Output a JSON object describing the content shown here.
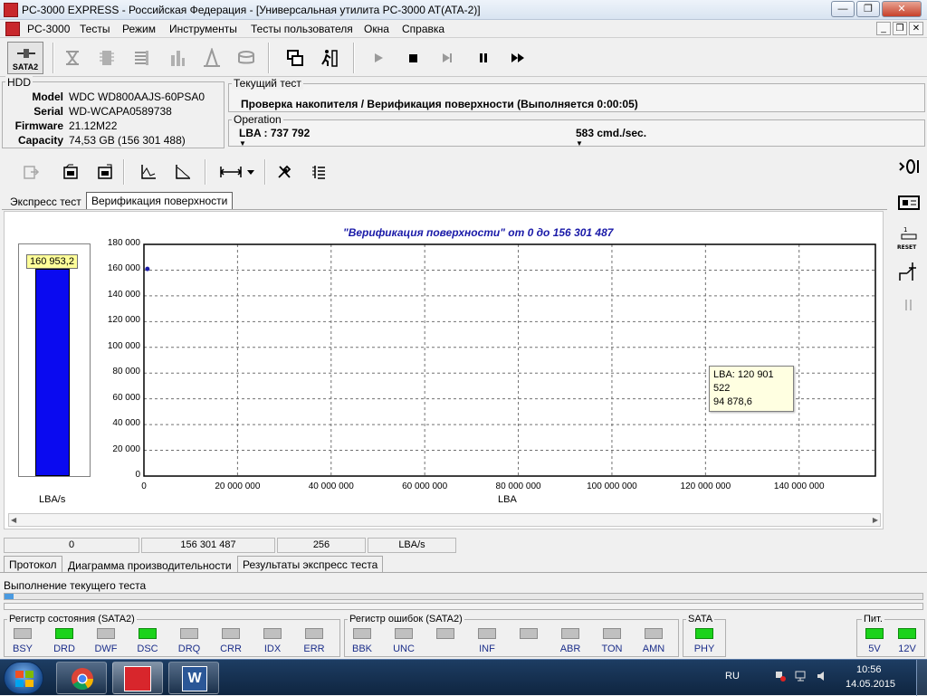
{
  "window": {
    "title": "PC-3000 EXPRESS - Российская Федерация - [Универсальная утилита PC-3000 AT(ATA-2)]",
    "btn_min": "—",
    "btn_max": "❐",
    "btn_close": "✕"
  },
  "menu": [
    "PC-3000",
    "Тесты",
    "Режим",
    "Инструменты",
    "Тесты пользователя",
    "Окна",
    "Справка"
  ],
  "mdi_buttons": [
    "_",
    "❐",
    "✕"
  ],
  "toolbar": {
    "sata_label": "SATA2"
  },
  "hdd": {
    "group_label": "HDD",
    "rows": [
      {
        "key": "Model",
        "value": "WDC WD800AAJS-60PSA0"
      },
      {
        "key": "Serial",
        "value": "WD-WCAPA0589738"
      },
      {
        "key": "Firmware",
        "value": "21.12M22"
      },
      {
        "key": "Capacity",
        "value": "74,53 GB (156 301 488)"
      }
    ]
  },
  "current_test": {
    "group_label": "Текущий тест",
    "text": "Проверка накопителя / Верификация поверхности (Выполняется 0:00:05)"
  },
  "operation": {
    "group_label": "Operation",
    "lba": "LBA : 737 792",
    "rate": "583 cmd./sec."
  },
  "chart_tabs": [
    "Экспресс тест",
    "Верификация поверхности"
  ],
  "chart_data": {
    "type": "line",
    "title": "\"Верификация поверхности\" от 0 до 156 301 487",
    "xlabel": "LBA",
    "ylabel": "",
    "xlim": [
      0,
      156301487
    ],
    "ylim": [
      0,
      180000
    ],
    "x_ticks": [
      "0",
      "20 000 000",
      "40 000 000",
      "60 000 000",
      "80 000 000",
      "100 000 000",
      "120 000 000",
      "140 000 000"
    ],
    "y_ticks": [
      "0",
      "20 000",
      "40 000",
      "60 000",
      "80 000",
      "100 000",
      "120 000",
      "140 000",
      "160 000",
      "180 000"
    ],
    "grid": true,
    "points": [
      {
        "x": 737792,
        "y": 160953.2
      }
    ],
    "side_bar": {
      "value": 160953.2,
      "label": "160 953,2",
      "unit": "LBA/s"
    },
    "tooltip": {
      "line1": "LBA: 120 901 522",
      "line2": "94 878,6"
    }
  },
  "status_cells": [
    "0",
    "156 301 487",
    "256",
    "LBA/s"
  ],
  "bottom_tabs": [
    "Протокол",
    "Диаграмма производительности",
    "Результаты экспресс теста"
  ],
  "progress": {
    "label": "Выполнение текущего теста",
    "fraction": 0.01
  },
  "status_register": {
    "label": "Регистр состояния (SATA2)",
    "leds": [
      {
        "name": "BSY",
        "on": false
      },
      {
        "name": "DRD",
        "on": true
      },
      {
        "name": "DWF",
        "on": false
      },
      {
        "name": "DSC",
        "on": true
      },
      {
        "name": "DRQ",
        "on": false
      },
      {
        "name": "CRR",
        "on": false
      },
      {
        "name": "IDX",
        "on": false
      },
      {
        "name": "ERR",
        "on": false
      }
    ]
  },
  "error_register": {
    "label": "Регистр ошибок  (SATA2)",
    "leds": [
      {
        "name": "BBK",
        "on": false
      },
      {
        "name": "UNC",
        "on": false
      },
      {
        "name": "",
        "on": false
      },
      {
        "name": "INF",
        "on": false
      },
      {
        "name": "",
        "on": false
      },
      {
        "name": "ABR",
        "on": false
      },
      {
        "name": "TON",
        "on": false
      },
      {
        "name": "AMN",
        "on": false
      }
    ]
  },
  "sata": {
    "label": "SATA",
    "led": "PHY",
    "on": true
  },
  "power": {
    "label": "Пит.",
    "leds": [
      {
        "name": "5V",
        "on": true
      },
      {
        "name": "12V",
        "on": true
      }
    ]
  },
  "taskbar": {
    "lang": "RU",
    "time": "10:56",
    "date": "14.05.2015"
  },
  "colors": {
    "bar": "#0a0af0",
    "title": "#1a1aa8",
    "tooltip_bg": "#ffffe1",
    "led_on": "#1bd31b"
  }
}
